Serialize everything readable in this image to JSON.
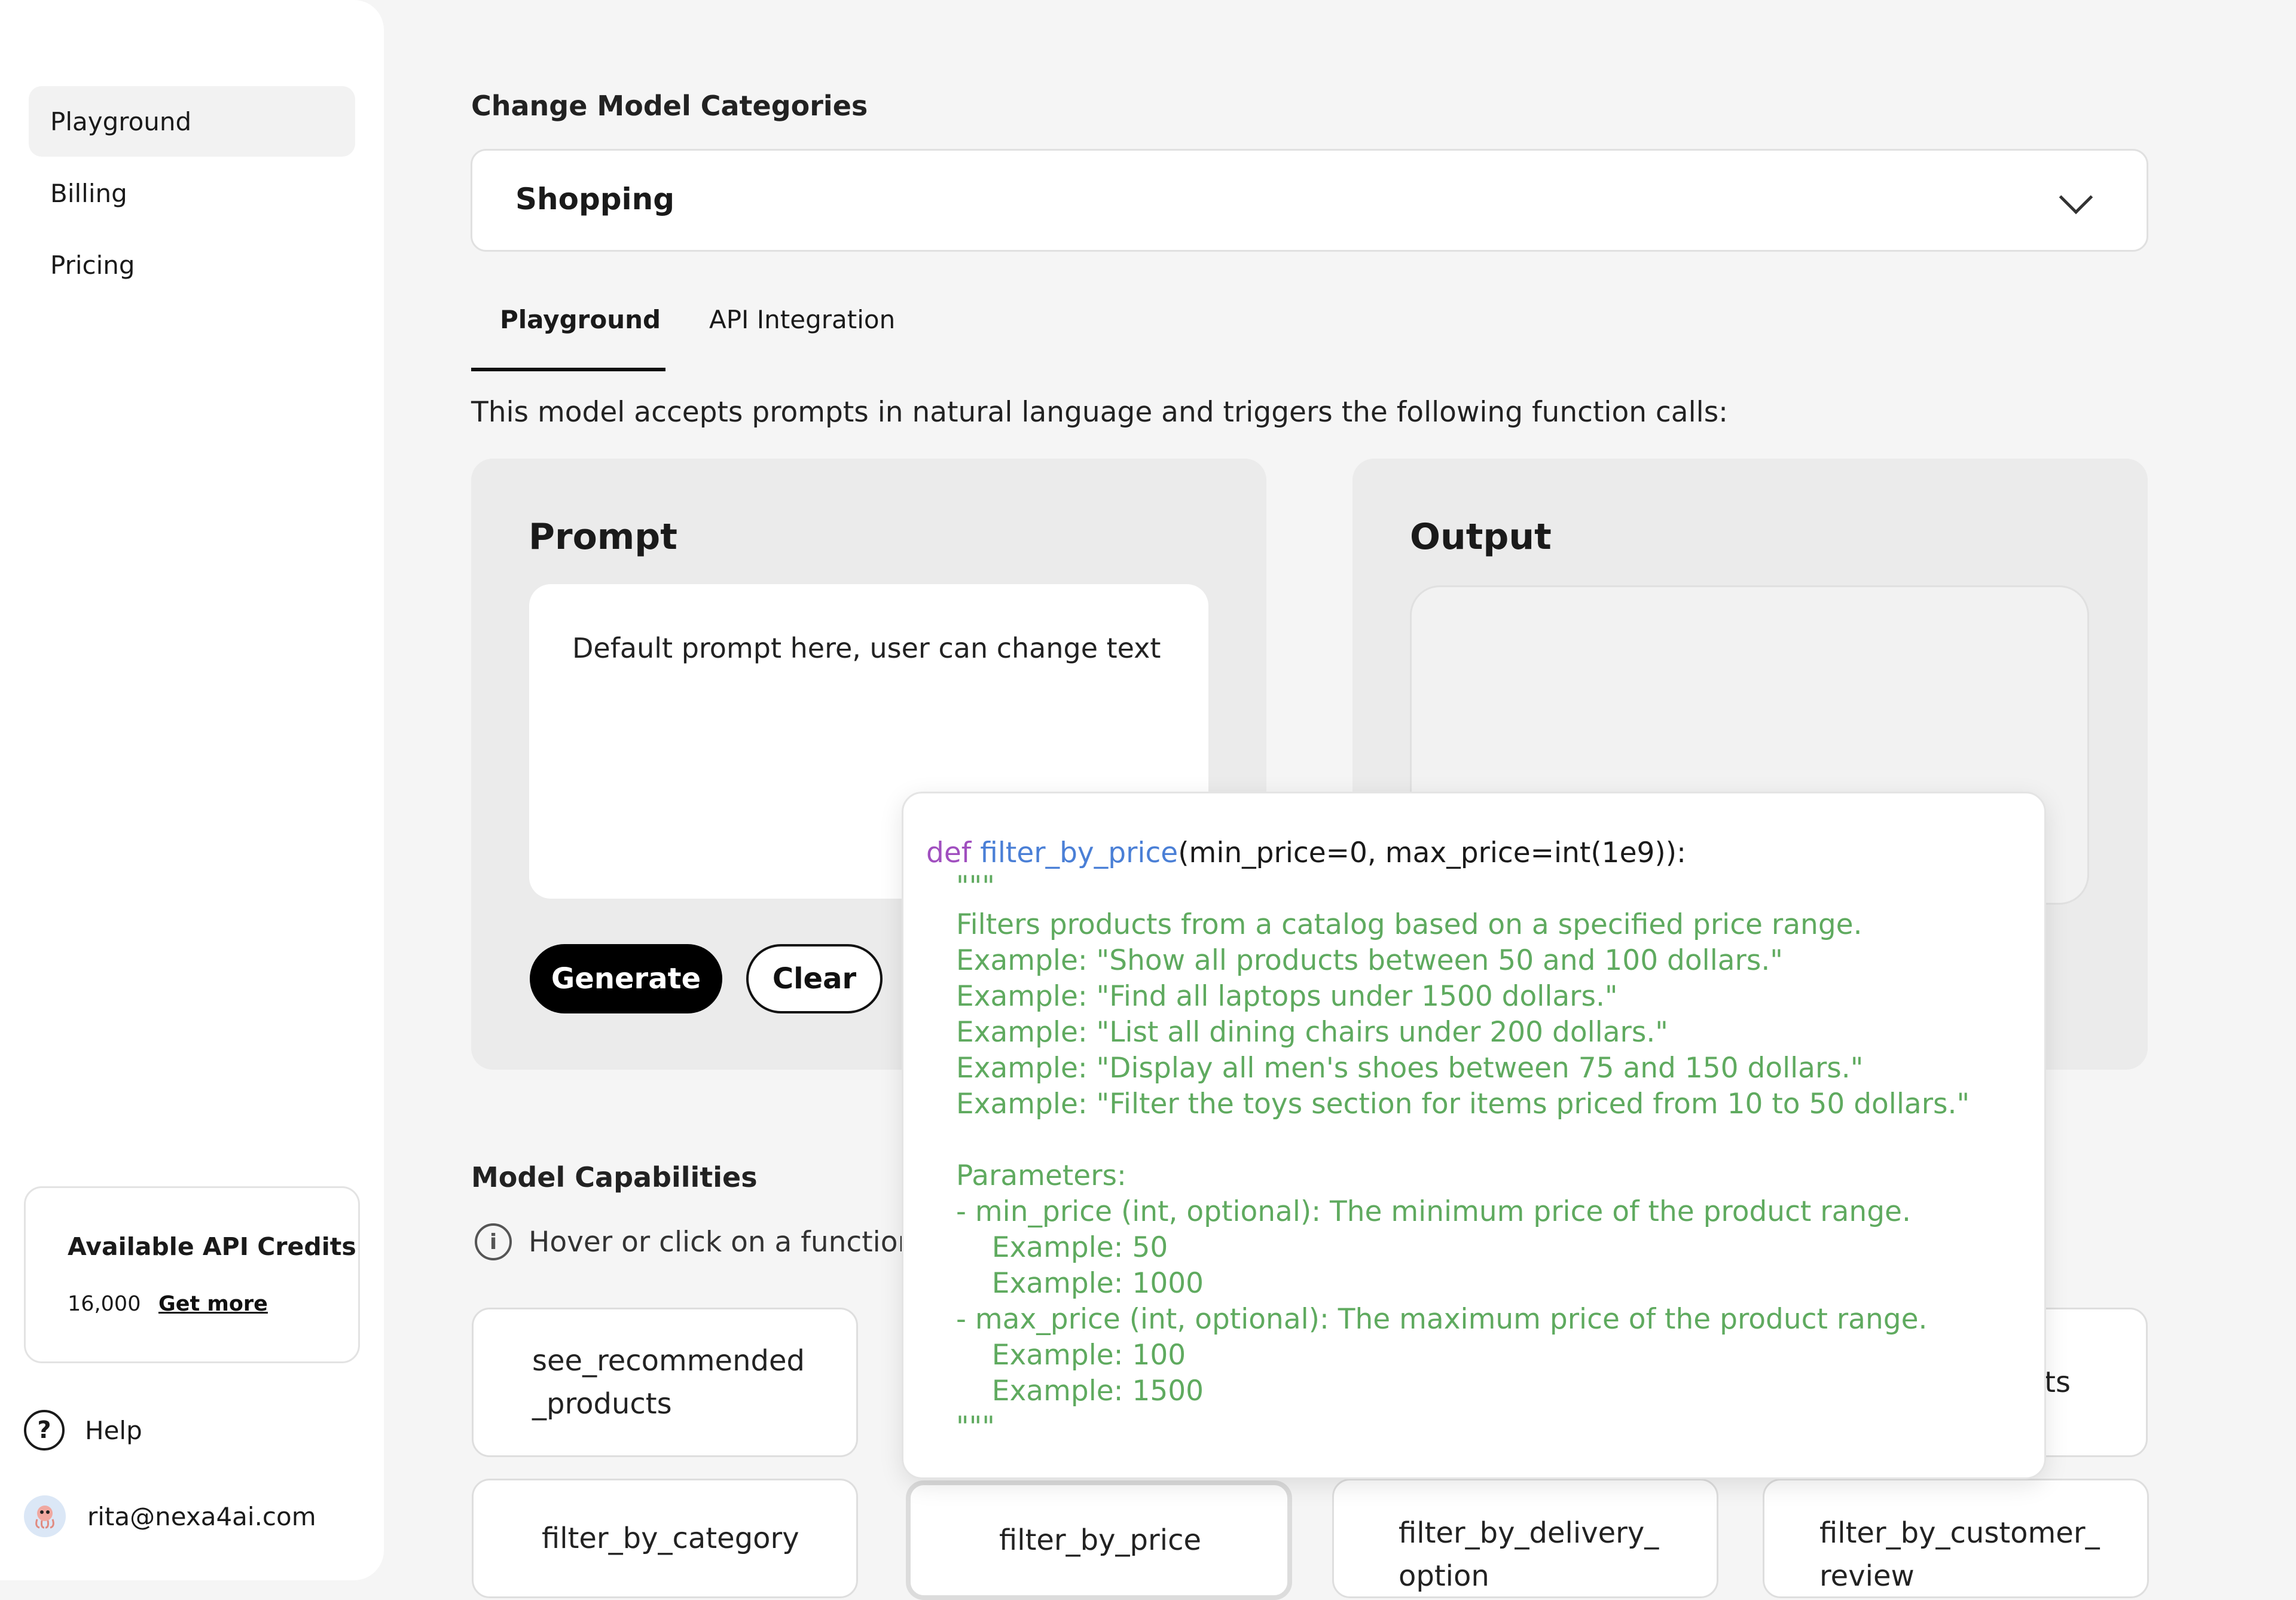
{
  "sidebar": {
    "items": [
      {
        "label": "Playground",
        "active": true
      },
      {
        "label": "Billing",
        "active": false
      },
      {
        "label": "Pricing",
        "active": false
      }
    ],
    "credits": {
      "title": "Available API Credits",
      "amount": "16,000",
      "link": "Get more"
    },
    "help": {
      "label": "Help",
      "icon": "question-circle-icon"
    },
    "user": {
      "email": "rita@nexa4ai.com",
      "avatar_icon": "octopus-avatar-icon"
    }
  },
  "main": {
    "category_heading": "Change Model Categories",
    "category_selected": "Shopping",
    "tabs": [
      {
        "label": "Playground",
        "active": true
      },
      {
        "label": "API Integration",
        "active": false
      }
    ],
    "description": "This model accepts prompts in natural language and triggers the following function calls:",
    "prompt": {
      "title": "Prompt",
      "text": "Default prompt here, user can change text"
    },
    "output": {
      "title": "Output"
    },
    "buttons": {
      "generate": "Generate",
      "clear": "Clear"
    },
    "capabilities": {
      "heading": "Model Capabilities",
      "hint": "Hover or click on a function t",
      "row1": [
        "see_recommended",
        "_products",
        "cts"
      ],
      "row2": [
        "filter_by_category",
        "filter_by_price",
        "filter_by_delivery_",
        "option",
        "filter_by_customer_",
        "review"
      ]
    }
  },
  "tooltip": {
    "keyword": "def",
    "function_name": "filter_by_price",
    "signature_rest": "(min_price=0, max_price=int(1e9)):",
    "lines": [
      "\"\"\"",
      "Filters products from a catalog based on a specified price range.",
      "Example: \"Show all products between 50 and 100 dollars.\"",
      "Example: \"Find all laptops under 1500 dollars.\"",
      "Example: \"List all dining chairs under 200 dollars.\"",
      "Example: \"Display all men's shoes between 75 and 150 dollars.\"",
      "Example: \"Filter the toys section for items priced from 10 to 50 dollars.\"",
      "",
      "Parameters:",
      "- min_price (int, optional): The minimum price of the product range.",
      "    Example: 50",
      "    Example: 1000",
      "- max_price (int, optional): The maximum price of the product range.",
      "    Example: 100",
      "    Example: 1500",
      "\"\"\""
    ]
  },
  "colors": {
    "keyword": "#a04fbf",
    "function": "#4a7fd6",
    "docstring": "#5faa5f"
  }
}
